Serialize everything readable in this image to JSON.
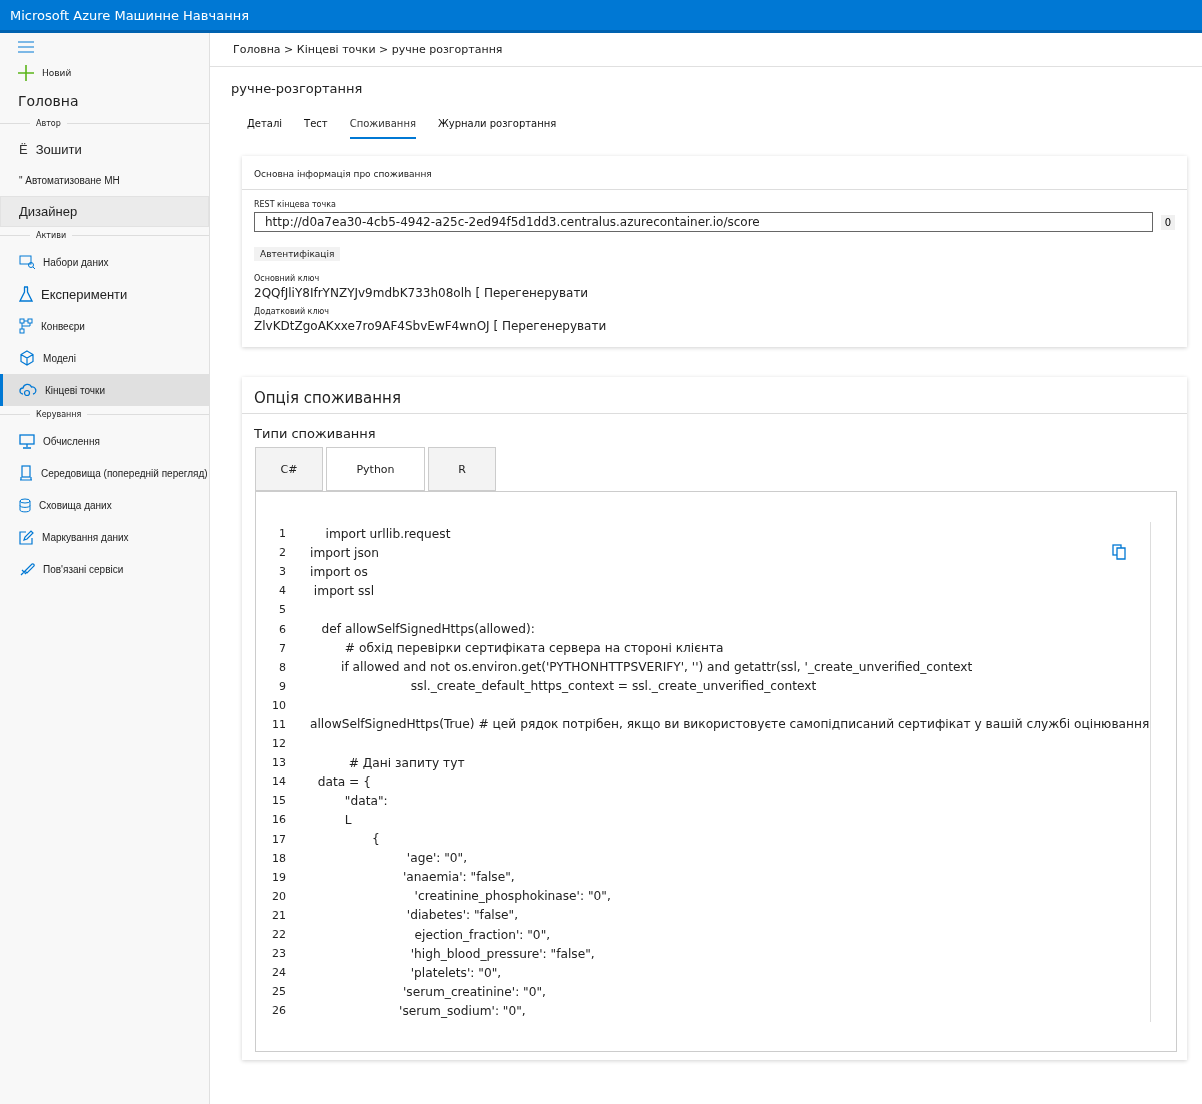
{
  "app_bar": {
    "title": "Microsoft Azure Машинне Навчання"
  },
  "sidebar": {
    "new_label": "Новий",
    "home_label": "Головна",
    "sections": [
      {
        "title": "Автор",
        "items": [
          {
            "label": "Зошити",
            "icon_char": "Ё",
            "kind": "glyph",
            "selected": false,
            "hovered": false
          },
          {
            "label": "\" Автоматизоване МН",
            "kind": "plain",
            "selected": false,
            "hovered": false
          },
          {
            "label": "Дизайнер",
            "kind": "plain",
            "selected": false,
            "hovered": true
          }
        ]
      },
      {
        "title": "Активи",
        "items": [
          {
            "label": "Набори даних",
            "kind": "datasets",
            "selected": false,
            "hovered": false
          },
          {
            "label": "Експерименти",
            "kind": "flask",
            "selected": false,
            "hovered": false
          },
          {
            "label": "Конвеєри",
            "kind": "pipeline",
            "selected": false,
            "hovered": false
          },
          {
            "label": "Моделі",
            "kind": "cube",
            "selected": false,
            "hovered": false
          },
          {
            "label": "Кінцеві точки",
            "kind": "cloud",
            "selected": true,
            "hovered": false
          }
        ]
      },
      {
        "title": "Керування",
        "items": [
          {
            "label": "Обчислення",
            "kind": "monitor",
            "selected": false,
            "hovered": false
          },
          {
            "label": "Середовища (попередній перегляд)",
            "kind": "device",
            "selected": false,
            "hovered": false
          },
          {
            "label": "Сховища даних",
            "kind": "database",
            "selected": false,
            "hovered": false
          },
          {
            "label": "Маркування даних",
            "kind": "edit",
            "selected": false,
            "hovered": false
          },
          {
            "label": "Пов'язані сервіси",
            "kind": "link",
            "selected": false,
            "hovered": false
          }
        ]
      }
    ]
  },
  "breadcrumb": "Головна > Кінцеві точки > ручне розгортання",
  "page_title": "ручне-розгортання",
  "tabs": [
    {
      "label": "Деталі",
      "selected": false
    },
    {
      "label": "Тест",
      "selected": false
    },
    {
      "label": "Споживання",
      "selected": true
    },
    {
      "label": "Журнали розгортання",
      "selected": false
    }
  ],
  "basics_card": {
    "title": "Основна інформація про споживання",
    "endpoint_label": "REST кінцева точка",
    "endpoint_value": "http://d0a7ea30-4cb5-4942-a25c-2ed94f5d1dd3.centralus.azurecontainer.io/score",
    "copy_char": "0",
    "auth_label": "Автентифікація",
    "keys": [
      {
        "label": "Основний ключ",
        "value": "2QQfJliY8IfrYNZYJv9mdbK733h08olh [ Перегенерувати"
      },
      {
        "label": "Додатковий ключ",
        "value": "ZlvKDtZgoAKxxe7ro9AF4SbvEwF4wnOJ [ Перегенерувати"
      }
    ]
  },
  "options_card": {
    "title": "Опція споживання",
    "types_label": "Типи споживання",
    "lang_tabs": [
      {
        "label": "C#",
        "selected": false
      },
      {
        "label": "Python",
        "selected": true
      },
      {
        "label": "R",
        "selected": false
      }
    ],
    "code_lines": [
      {
        "number": "1",
        "text": "    import urllib.request"
      },
      {
        "number": "2",
        "text": "import json"
      },
      {
        "number": "3",
        "text": "import os"
      },
      {
        "number": "4",
        "text": " import ssl"
      },
      {
        "number": "5"
      },
      {
        "number": "6",
        "text": "   def allowSelfSignedHttps(allowed):"
      },
      {
        "number": "7",
        "text": "         # обхід перевірки сертифіката сервера на стороні клієнта"
      },
      {
        "number": "8",
        "text": "        if allowed and not os.environ.get('PYTHONHTTPSVERIFY', '') and getattr(ssl, '_create_unverified_context"
      },
      {
        "number": "9",
        "text": "                          ssl._create_default_https_context = ssl._create_unverified_context"
      },
      {
        "number": "10"
      },
      {
        "number": "11",
        "text": "allowSelfSignedHttps(True) # цей рядок потрібен, якщо ви використовуєте самопідписаний сертифікат у вашій службі оцінювання"
      },
      {
        "number": "12"
      },
      {
        "number": "13",
        "text": "          # Дані запиту тут"
      },
      {
        "number": "14",
        "text": "  data = {"
      },
      {
        "number": "15",
        "text": "         \"data\":"
      },
      {
        "number": "16",
        "text": "         L"
      },
      {
        "number": "17",
        "text": "                {"
      },
      {
        "number": "18",
        "text": "                         'age': \"0\","
      },
      {
        "number": "19",
        "text": "                        'anaemia': \"false\","
      },
      {
        "number": "20",
        "text": "                           'creatinine_phosphokinase': \"0\","
      },
      {
        "number": "21",
        "text": "                         'diabetes': \"false\","
      },
      {
        "number": "22",
        "text": "                           ejection_fraction': \"0\","
      },
      {
        "number": "23",
        "text": "                          'high_blood_pressure': \"false\","
      },
      {
        "number": "24",
        "text": "                          'platelets': \"0\","
      },
      {
        "number": "25",
        "text": "                        'serum_creatinine': \"0\","
      },
      {
        "number": "26",
        "text": "                       'serum_sodium': \"0\","
      }
    ]
  }
}
